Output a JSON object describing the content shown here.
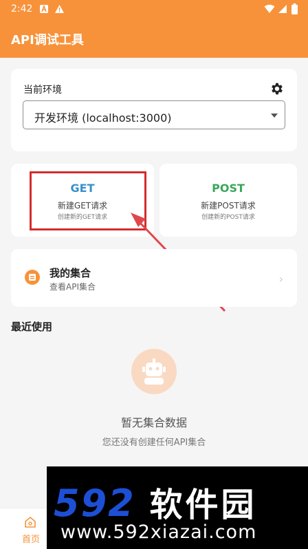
{
  "status_bar": {
    "time": "2:42"
  },
  "app": {
    "title": "API调试工具"
  },
  "environment": {
    "label": "当前环境",
    "selected": "开发环境 (localhost:3000)"
  },
  "requests": {
    "get": {
      "method": "GET",
      "label": "新建GET请求",
      "desc": "创建新的GET请求",
      "color": "#3a8fcc"
    },
    "post": {
      "method": "POST",
      "label": "新建POST请求",
      "desc": "创建新的POST请求",
      "color": "#3aa75a"
    }
  },
  "collections": {
    "title": "我的集合",
    "subtitle": "查看API集合"
  },
  "recent": {
    "title": "最近使用",
    "empty_title": "暂无集合数据",
    "empty_subtitle": "您还没有创建任何API集合"
  },
  "bottom_nav": {
    "home_label": "首页"
  },
  "watermark": {
    "brand": "592",
    "brand_cn": "软件园",
    "url": "www.592xiazai.com"
  },
  "colors": {
    "accent": "#f7923a",
    "highlight": "#d52b2b"
  }
}
